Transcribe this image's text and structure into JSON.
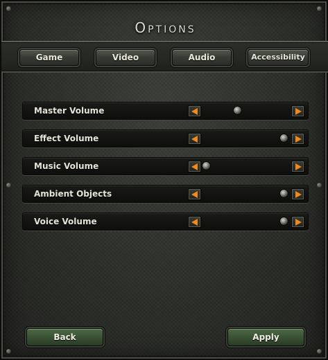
{
  "window": {
    "title": "Options"
  },
  "tabs": [
    {
      "label": "Game"
    },
    {
      "label": "Video"
    },
    {
      "label": "Audio"
    },
    {
      "label": "Accessibility"
    }
  ],
  "sliders": [
    {
      "label": "Master Volume",
      "value_fraction": 0.4
    },
    {
      "label": "Effect Volume",
      "value_fraction": 1.0
    },
    {
      "label": "Music Volume",
      "value_fraction": 0.0
    },
    {
      "label": "Ambient Objects",
      "value_fraction": 1.0
    },
    {
      "label": "Voice Volume",
      "value_fraction": 1.0
    }
  ],
  "footer": {
    "back_label": "Back",
    "apply_label": "Apply"
  },
  "colors": {
    "arrow_accent": "#f08a1c",
    "button_green": "#3c5436",
    "panel_bg": "#2a2c28"
  },
  "icons": {
    "left": "arrow-left-icon",
    "right": "arrow-right-icon",
    "knob": "slider-knob"
  }
}
